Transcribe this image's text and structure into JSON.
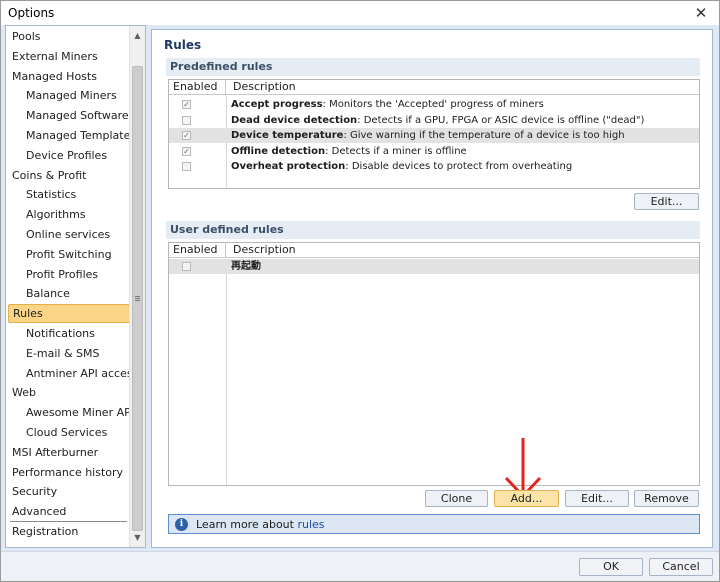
{
  "window": {
    "title": "Options",
    "close_label": "✕"
  },
  "sidebar": {
    "items": [
      {
        "label": "Pools",
        "level": 0
      },
      {
        "label": "External Miners",
        "level": 0
      },
      {
        "label": "Managed Hosts",
        "level": 0
      },
      {
        "label": "Managed Miners",
        "level": 1
      },
      {
        "label": "Managed Software",
        "level": 1
      },
      {
        "label": "Managed Templates",
        "level": 1
      },
      {
        "label": "Device Profiles",
        "level": 1
      },
      {
        "label": "Coins & Profit",
        "level": 0
      },
      {
        "label": "Statistics",
        "level": 1
      },
      {
        "label": "Algorithms",
        "level": 1
      },
      {
        "label": "Online services",
        "level": 1
      },
      {
        "label": "Profit Switching",
        "level": 1
      },
      {
        "label": "Profit Profiles",
        "level": 1
      },
      {
        "label": "Balance",
        "level": 1
      },
      {
        "label": "Rules",
        "level": 0,
        "selected": true
      },
      {
        "label": "Notifications",
        "level": 1
      },
      {
        "label": "E-mail & SMS",
        "level": 1
      },
      {
        "label": "Antminer API access",
        "level": 1
      },
      {
        "label": "Web",
        "level": 0
      },
      {
        "label": "Awesome Miner API",
        "level": 1
      },
      {
        "label": "Cloud Services",
        "level": 1
      },
      {
        "label": "MSI Afterburner",
        "level": 0
      },
      {
        "label": "Performance history",
        "level": 0
      },
      {
        "label": "Security",
        "level": 0
      },
      {
        "label": "Advanced",
        "level": 0
      },
      {
        "label": "Registration",
        "level": 0
      }
    ]
  },
  "main": {
    "title": "Rules",
    "predefined": {
      "header": "Predefined rules",
      "col_enabled": "Enabled",
      "col_description": "Description",
      "rows": [
        {
          "name": "Accept progress",
          "desc": ": Monitors the 'Accepted' progress of miners",
          "enabled": true,
          "selected": false
        },
        {
          "name": "Dead device detection",
          "desc": ": Detects if a GPU, FPGA or ASIC device is offline (\"dead\")",
          "enabled": false,
          "selected": false
        },
        {
          "name": "Device temperature",
          "desc": ": Give warning if the temperature of a device is too high",
          "enabled": true,
          "selected": true
        },
        {
          "name": "Offline detection",
          "desc": ": Detects if a miner is offline",
          "enabled": true,
          "selected": false
        },
        {
          "name": "Overheat protection",
          "desc": ": Disable devices to protect from overheating",
          "enabled": false,
          "selected": false
        }
      ],
      "edit_label": "Edit..."
    },
    "user": {
      "header": "User defined rules",
      "col_enabled": "Enabled",
      "col_description": "Description",
      "rows": [
        {
          "name": "再起動",
          "desc": "",
          "enabled": false,
          "selected": true
        }
      ],
      "clone_label": "Clone",
      "add_label": "Add...",
      "edit_label": "Edit...",
      "remove_label": "Remove"
    },
    "info": {
      "prefix": "Learn more about",
      "link": "rules"
    }
  },
  "footer": {
    "ok_label": "OK",
    "cancel_label": "Cancel"
  },
  "colors": {
    "selection": "#fbd585",
    "accent": "#2d62a8",
    "arrow": "#e8231f",
    "panel_bg": "#dfe9f5"
  }
}
